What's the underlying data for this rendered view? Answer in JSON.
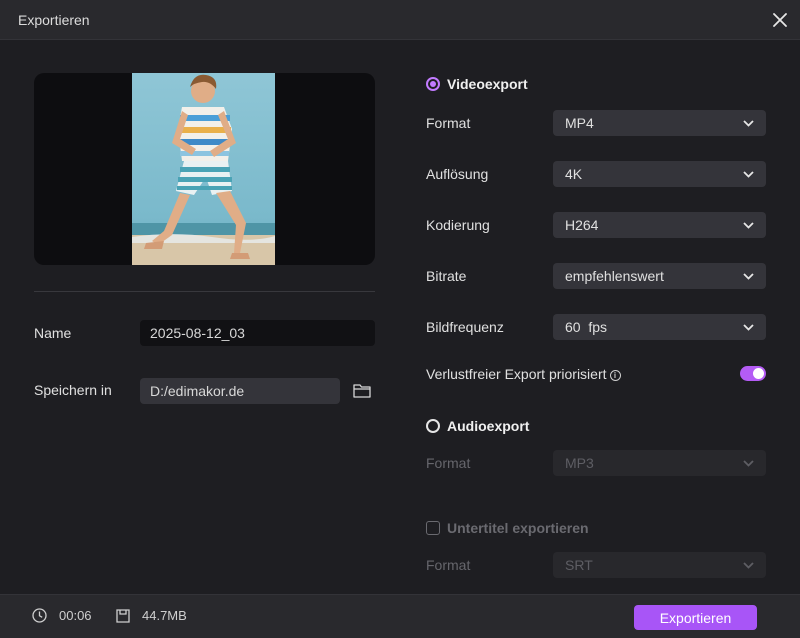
{
  "window": {
    "title": "Exportieren"
  },
  "left": {
    "name_label": "Name",
    "name_value": "2025-08-12_03",
    "save_label": "Speichern in",
    "save_path": "D:/edimakor.de"
  },
  "video": {
    "label": "Videoexport",
    "format_label": "Format",
    "format_value": "MP4",
    "resolution_label": "Auflösung",
    "resolution_value": "4K",
    "encoding_label": "Kodierung",
    "encoding_value": "H264",
    "bitrate_label": "Bitrate",
    "bitrate_value": "empfehlenswert",
    "framerate_label": "Bildfrequenz",
    "framerate_value": "60  fps",
    "lossless_label": "Verlustfreier Export priorisiert",
    "lossless_on": true
  },
  "audio": {
    "label": "Audioexport",
    "format_label": "Format",
    "format_value": "MP3"
  },
  "subtitle": {
    "label": "Untertitel exportieren",
    "format_label": "Format",
    "format_value": "SRT"
  },
  "footer": {
    "duration": "00:06",
    "size": "44.7MB",
    "export_label": "Exportieren"
  },
  "colors": {
    "accent": "#a855f7",
    "background": "#1e1e22",
    "panel": "#29292d"
  }
}
